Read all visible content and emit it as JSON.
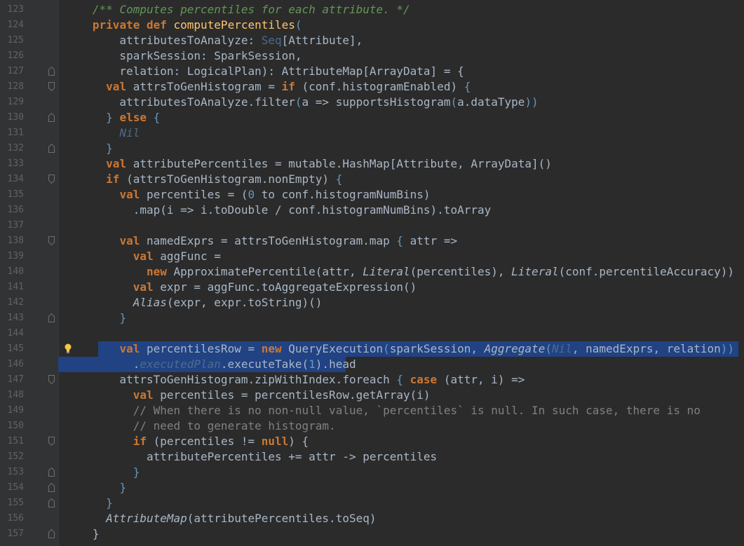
{
  "lines": [
    {
      "n": "123",
      "fold": "none",
      "sel": "",
      "tokens": [
        [
          "   ",
          ""
        ],
        [
          "/** Computes percentiles for each attribute. */",
          "dc"
        ]
      ]
    },
    {
      "n": "124",
      "fold": "none",
      "sel": "",
      "tokens": [
        [
          "   ",
          ""
        ],
        [
          "private def ",
          "kw"
        ],
        [
          "computePercentiles",
          "fn"
        ],
        [
          "(",
          "br"
        ]
      ]
    },
    {
      "n": "125",
      "fold": "none",
      "sel": "",
      "tokens": [
        [
          "       attributesToAnalyze: ",
          ""
        ],
        [
          "Seq",
          "sq"
        ],
        [
          "[Attribute]",
          ""
        ],
        [
          ",",
          ""
        ]
      ]
    },
    {
      "n": "126",
      "fold": "none",
      "sel": "",
      "tokens": [
        [
          "       sparkSession: SparkSession,",
          ""
        ]
      ]
    },
    {
      "n": "127",
      "fold": "end",
      "sel": "",
      "tokens": [
        [
          "       relation: LogicalPlan",
          ""
        ],
        [
          ")",
          ""
        ],
        [
          ": AttributeMap[ArrayData] = {",
          ""
        ]
      ]
    },
    {
      "n": "128",
      "fold": "start",
      "sel": "",
      "tokens": [
        [
          "     ",
          ""
        ],
        [
          "val ",
          "kw"
        ],
        [
          "attrsToGenHistogram = ",
          ""
        ],
        [
          "if ",
          "kw"
        ],
        [
          "(conf.histogramEnabled) ",
          ""
        ],
        [
          "{",
          "br"
        ]
      ]
    },
    {
      "n": "129",
      "fold": "none",
      "sel": "",
      "tokens": [
        [
          "       attributesToAnalyze.filter",
          ""
        ],
        [
          "(",
          "br"
        ],
        [
          "a => supportsHistogram",
          ""
        ],
        [
          "(",
          "br"
        ],
        [
          "a.dataType",
          ""
        ],
        [
          "))",
          "br"
        ]
      ]
    },
    {
      "n": "130",
      "fold": "end",
      "sel": "",
      "tokens": [
        [
          "     ",
          ""
        ],
        [
          "}",
          "br"
        ],
        [
          " ",
          ""
        ],
        [
          "else ",
          "kw"
        ],
        [
          "{",
          "br"
        ]
      ]
    },
    {
      "n": "131",
      "fold": "none",
      "sel": "",
      "tokens": [
        [
          "       ",
          ""
        ],
        [
          "Nil",
          "sq it"
        ]
      ]
    },
    {
      "n": "132",
      "fold": "end",
      "sel": "",
      "tokens": [
        [
          "     ",
          ""
        ],
        [
          "}",
          "br"
        ]
      ]
    },
    {
      "n": "133",
      "fold": "none",
      "sel": "",
      "tokens": [
        [
          "     ",
          ""
        ],
        [
          "val ",
          "kw"
        ],
        [
          "attributePercentiles = mutable.HashMap[Attribute, ArrayData]()",
          ""
        ]
      ]
    },
    {
      "n": "134",
      "fold": "start",
      "sel": "",
      "tokens": [
        [
          "     ",
          ""
        ],
        [
          "if ",
          "kw"
        ],
        [
          "(attrsToGenHistogram.nonEmpty) ",
          ""
        ],
        [
          "{",
          "br"
        ]
      ]
    },
    {
      "n": "135",
      "fold": "none",
      "sel": "",
      "tokens": [
        [
          "       ",
          ""
        ],
        [
          "val ",
          "kw"
        ],
        [
          "percentiles = (",
          ""
        ],
        [
          "0",
          "nm"
        ],
        [
          " to conf.histogramNumBins)",
          ""
        ]
      ]
    },
    {
      "n": "136",
      "fold": "none",
      "sel": "",
      "tokens": [
        [
          "         .map(i => i.toDouble / conf.histogramNumBins).toArray",
          ""
        ]
      ]
    },
    {
      "n": "137",
      "fold": "none",
      "sel": "",
      "tokens": [
        [
          "",
          ""
        ]
      ]
    },
    {
      "n": "138",
      "fold": "start",
      "sel": "",
      "tokens": [
        [
          "       ",
          ""
        ],
        [
          "val ",
          "kw"
        ],
        [
          "namedExprs = attrsToGenHistogram.map ",
          ""
        ],
        [
          "{",
          "br"
        ],
        [
          " attr =>",
          ""
        ]
      ]
    },
    {
      "n": "139",
      "fold": "none",
      "sel": "",
      "tokens": [
        [
          "         ",
          ""
        ],
        [
          "val ",
          "kw"
        ],
        [
          "aggFunc =",
          ""
        ]
      ]
    },
    {
      "n": "140",
      "fold": "none",
      "sel": "",
      "tokens": [
        [
          "           ",
          ""
        ],
        [
          "new ",
          "kw"
        ],
        [
          "ApproximatePercentile(attr, ",
          ""
        ],
        [
          "Literal",
          "it"
        ],
        [
          "(percentiles), ",
          ""
        ],
        [
          "Literal",
          "it"
        ],
        [
          "(conf.percentileAccuracy))",
          ""
        ]
      ]
    },
    {
      "n": "141",
      "fold": "none",
      "sel": "",
      "tokens": [
        [
          "         ",
          ""
        ],
        [
          "val ",
          "kw"
        ],
        [
          "expr = aggFunc.toAggregateExpression()",
          ""
        ]
      ]
    },
    {
      "n": "142",
      "fold": "none",
      "sel": "",
      "tokens": [
        [
          "         ",
          ""
        ],
        [
          "Alias",
          "it"
        ],
        [
          "(expr, expr.toString)()",
          ""
        ]
      ]
    },
    {
      "n": "143",
      "fold": "end",
      "sel": "",
      "tokens": [
        [
          "       ",
          ""
        ],
        [
          "}",
          "br"
        ]
      ]
    },
    {
      "n": "144",
      "fold": "none",
      "sel": "",
      "tokens": [
        [
          "",
          ""
        ]
      ]
    },
    {
      "n": "145",
      "fold": "none",
      "sel": "part",
      "bulb": true,
      "tokens": [
        [
          "       ",
          ""
        ],
        [
          "val ",
          "kw"
        ],
        [
          "percentilesRow = ",
          ""
        ],
        [
          "new ",
          "kw"
        ],
        [
          "QueryExecution",
          ""
        ],
        [
          "(",
          "br"
        ],
        [
          "sparkSession, ",
          ""
        ],
        [
          "Aggregate",
          "it"
        ],
        [
          "(",
          "br"
        ],
        [
          "Nil",
          "sq it"
        ],
        [
          ", namedExprs, relation",
          ""
        ],
        [
          "))",
          "br"
        ]
      ]
    },
    {
      "n": "146",
      "fold": "none",
      "sel": "end",
      "tokens": [
        [
          "         .",
          ""
        ],
        [
          "executedPlan",
          "sq it"
        ],
        [
          ".executeTake(",
          ""
        ],
        [
          "1",
          "nm"
        ],
        [
          ").head",
          ""
        ]
      ]
    },
    {
      "n": "147",
      "fold": "start",
      "sel": "",
      "tokens": [
        [
          "       attrsToGenHistogram.zipWithIndex.foreach ",
          ""
        ],
        [
          "{",
          "br"
        ],
        [
          " ",
          ""
        ],
        [
          "case ",
          "kw"
        ],
        [
          "(attr, i) =>",
          ""
        ]
      ]
    },
    {
      "n": "148",
      "fold": "none",
      "sel": "",
      "tokens": [
        [
          "         ",
          ""
        ],
        [
          "val ",
          "kw"
        ],
        [
          "percentiles = percentilesRow.getArray(i)",
          ""
        ]
      ]
    },
    {
      "n": "149",
      "fold": "none",
      "sel": "",
      "tokens": [
        [
          "         ",
          ""
        ],
        [
          "// When there is no non-null value, `percentiles` is null. In such case, there is no",
          "cm"
        ]
      ]
    },
    {
      "n": "150",
      "fold": "none",
      "sel": "",
      "tokens": [
        [
          "         ",
          ""
        ],
        [
          "// need to generate histogram.",
          "cm"
        ]
      ]
    },
    {
      "n": "151",
      "fold": "start",
      "sel": "",
      "tokens": [
        [
          "         ",
          ""
        ],
        [
          "if ",
          "kw"
        ],
        [
          "(percentiles != ",
          ""
        ],
        [
          "null",
          "kw"
        ],
        [
          ") {",
          ""
        ]
      ]
    },
    {
      "n": "152",
      "fold": "none",
      "sel": "",
      "tokens": [
        [
          "           attributePercentiles += attr -> percentiles",
          ""
        ]
      ]
    },
    {
      "n": "153",
      "fold": "end",
      "sel": "",
      "tokens": [
        [
          "         ",
          ""
        ],
        [
          "}",
          "br"
        ]
      ]
    },
    {
      "n": "154",
      "fold": "end",
      "sel": "",
      "tokens": [
        [
          "       ",
          ""
        ],
        [
          "}",
          "br"
        ]
      ]
    },
    {
      "n": "155",
      "fold": "end",
      "sel": "",
      "tokens": [
        [
          "     ",
          ""
        ],
        [
          "}",
          "br"
        ]
      ]
    },
    {
      "n": "156",
      "fold": "none",
      "sel": "",
      "tokens": [
        [
          "     ",
          ""
        ],
        [
          "AttributeMap",
          "it"
        ],
        [
          "(attributePercentiles.toSeq)",
          ""
        ]
      ]
    },
    {
      "n": "157",
      "fold": "end",
      "sel": "",
      "tokens": [
        [
          "   }",
          ""
        ]
      ]
    }
  ],
  "icons": {
    "fold": "fold-marker-icon",
    "bulb": "lightbulb-icon"
  },
  "colors": {
    "background": "#2b2b2b",
    "gutter": "#313335",
    "selection": "#214283",
    "keyword": "#cc7832",
    "comment": "#808080",
    "number": "#6897bb",
    "function": "#ffc66d",
    "doc": "#629755"
  }
}
